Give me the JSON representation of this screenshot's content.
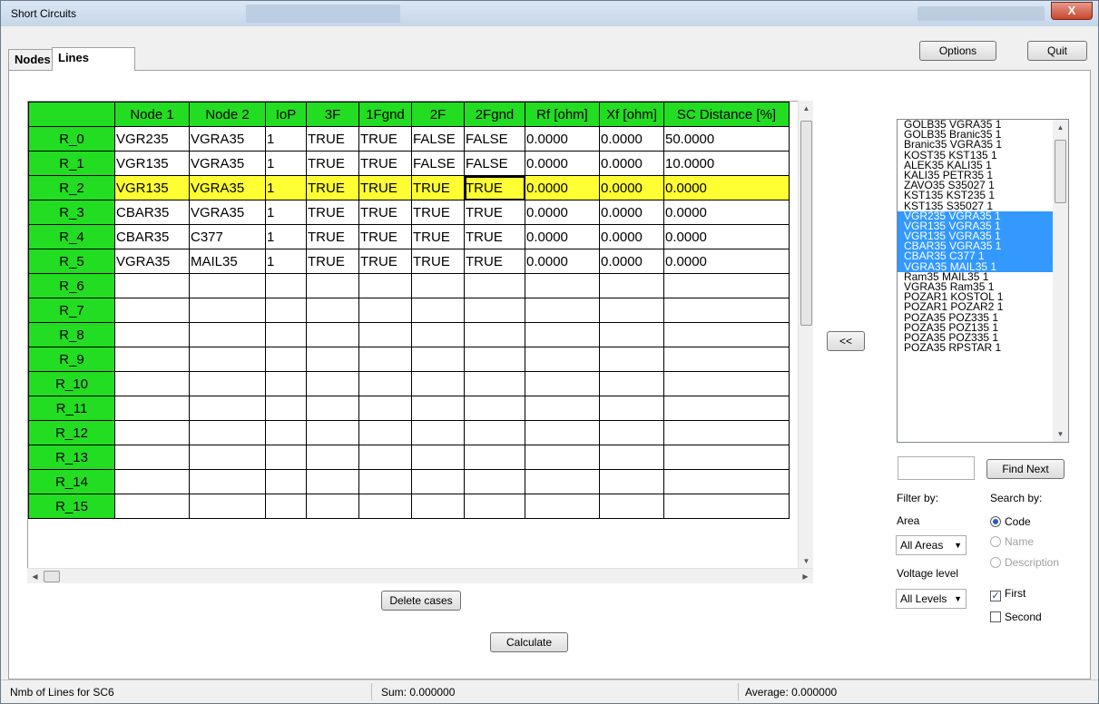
{
  "window": {
    "title": "Short Circuits",
    "close_glyph": "X"
  },
  "toolbar": {
    "options_label": "Options",
    "quit_label": "Quit"
  },
  "tabs": [
    {
      "label": "Nodes"
    },
    {
      "label": "Lines"
    }
  ],
  "grid": {
    "headers": [
      "",
      "Node 1",
      "Node 2",
      "IoP",
      "3F",
      "1Fgnd",
      "2F",
      "2Fgnd",
      "Rf [ohm]",
      "Xf [ohm]",
      "SC Distance [%]"
    ],
    "rows": [
      [
        "R_0",
        "VGR235",
        "VGRA35",
        "1",
        "TRUE",
        "TRUE",
        "FALSE",
        "FALSE",
        "0.0000",
        "0.0000",
        "50.0000"
      ],
      [
        "R_1",
        "VGR135",
        "VGRA35",
        "1",
        "TRUE",
        "TRUE",
        "FALSE",
        "FALSE",
        "0.0000",
        "0.0000",
        "10.0000"
      ],
      [
        "R_2",
        "VGR135",
        "VGRA35",
        "1",
        "TRUE",
        "TRUE",
        "TRUE",
        "TRUE",
        "0.0000",
        "0.0000",
        "0.0000"
      ],
      [
        "R_3",
        "CBAR35",
        "VGRA35",
        "1",
        "TRUE",
        "TRUE",
        "TRUE",
        "TRUE",
        "0.0000",
        "0.0000",
        "0.0000"
      ],
      [
        "R_4",
        "CBAR35",
        "C377",
        "1",
        "TRUE",
        "TRUE",
        "TRUE",
        "TRUE",
        "0.0000",
        "0.0000",
        "0.0000"
      ],
      [
        "R_5",
        "VGRA35",
        "MAIL35",
        "1",
        "TRUE",
        "TRUE",
        "TRUE",
        "TRUE",
        "0.0000",
        "0.0000",
        "0.0000"
      ],
      [
        "R_6",
        "",
        "",
        "",
        "",
        "",
        "",
        "",
        "",
        "",
        ""
      ],
      [
        "R_7",
        "",
        "",
        "",
        "",
        "",
        "",
        "",
        "",
        "",
        ""
      ],
      [
        "R_8",
        "",
        "",
        "",
        "",
        "",
        "",
        "",
        "",
        "",
        ""
      ],
      [
        "R_9",
        "",
        "",
        "",
        "",
        "",
        "",
        "",
        "",
        "",
        ""
      ],
      [
        "R_10",
        "",
        "",
        "",
        "",
        "",
        "",
        "",
        "",
        "",
        ""
      ],
      [
        "R_11",
        "",
        "",
        "",
        "",
        "",
        "",
        "",
        "",
        "",
        ""
      ],
      [
        "R_12",
        "",
        "",
        "",
        "",
        "",
        "",
        "",
        "",
        "",
        ""
      ],
      [
        "R_13",
        "",
        "",
        "",
        "",
        "",
        "",
        "",
        "",
        "",
        ""
      ],
      [
        "R_14",
        "",
        "",
        "",
        "",
        "",
        "",
        "",
        "",
        "",
        ""
      ],
      [
        "R_15",
        "",
        "",
        "",
        "",
        "",
        "",
        "",
        "",
        "",
        ""
      ]
    ],
    "selected_row": 2,
    "current_cell_col": 7
  },
  "move_button_label": "<<",
  "line_list": {
    "items": [
      "GOLB35  VGRA35  1",
      "GOLB35  Branic35  1",
      "Branic35  VGRA35  1",
      "KOST35  KST135  1",
      "ALEK35  KALI35  1",
      "KALI35  PETR35  1",
      "ZAVO35  S35027  1",
      "KST135  KST235  1",
      "KST135  S35027  1",
      "VGR235  VGRA35  1",
      "VGR135  VGRA35  1",
      "VGR135  VGRA35  1",
      "CBAR35  VGRA35  1",
      "CBAR35  C377  1",
      "VGRA35  MAIL35  1",
      "Ram35  MAIL35  1",
      "VGRA35  Ram35  1",
      "POZAR1  KOSTOL  1",
      "POZAR1  POZAR2  1",
      "POZA35  POZ335  1",
      "POZA35  POZ135  1",
      "POZA35  POZ335  1",
      "POZA35  RPSTAR  1"
    ],
    "selected_indices": [
      9,
      10,
      11,
      12,
      13,
      14
    ]
  },
  "search": {
    "find_next_label": "Find Next",
    "value": ""
  },
  "filter": {
    "label": "Filter by:",
    "area_label": "Area",
    "area_value": "All Areas",
    "voltage_label": "Voltage level",
    "voltage_value": "All Levels"
  },
  "search_by": {
    "label": "Search by:",
    "options": [
      {
        "label": "Code",
        "checked": true,
        "enabled": true
      },
      {
        "label": "Name",
        "checked": false,
        "enabled": false
      },
      {
        "label": "Description",
        "checked": false,
        "enabled": false
      }
    ]
  },
  "checks": [
    {
      "label": "First",
      "checked": true
    },
    {
      "label": "Second",
      "checked": false
    }
  ],
  "actions": {
    "delete_label": "Delete cases",
    "calculate_label": "Calculate"
  },
  "status": {
    "left": "Nmb of Lines for SC6",
    "sum": "Sum: 0.000000",
    "average": "Average: 0.000000"
  }
}
